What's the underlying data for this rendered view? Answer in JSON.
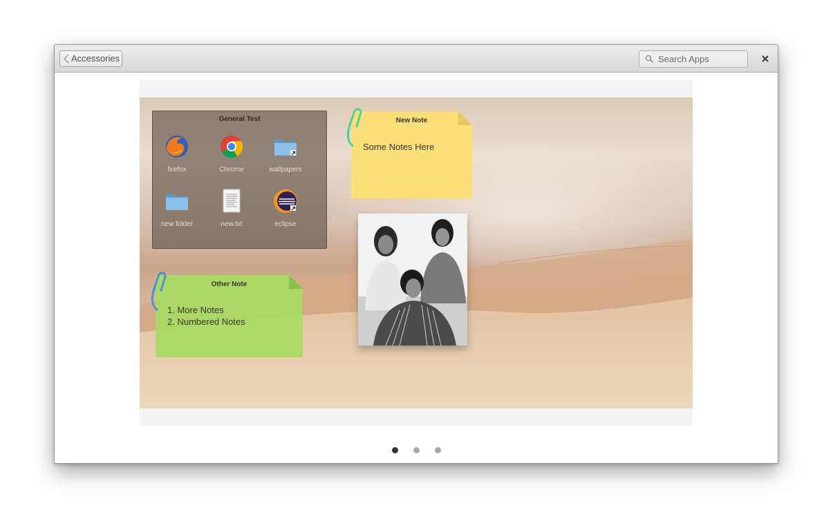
{
  "window": {
    "back_label": "Accessories",
    "search_placeholder": "Search Apps"
  },
  "folder": {
    "title": "General Test",
    "apps": [
      {
        "label": "firefox",
        "icon": "firefox-icon"
      },
      {
        "label": "Chrome",
        "icon": "chrome-icon"
      },
      {
        "label": "wallpapers",
        "icon": "folder-link-icon"
      },
      {
        "label": "new folder",
        "icon": "folder-icon"
      },
      {
        "label": "new.txt",
        "icon": "text-file-icon"
      },
      {
        "label": "eclipse",
        "icon": "eclipse-icon"
      }
    ]
  },
  "notes": {
    "new_note": {
      "title": "New Note",
      "body": "Some Notes Here",
      "color": "#fbe07a"
    },
    "other_note": {
      "title": "Other Note",
      "items": [
        "1. More Notes",
        "2. Numbered Notes"
      ],
      "color": "#a7dc62"
    }
  },
  "pager": {
    "count": 3,
    "active": 0
  },
  "colors": {
    "titlebar": "#e0e0e0",
    "note_yellow": "#fbe07a",
    "note_green": "#a7dc62",
    "clip_teal": "#4ecfa0",
    "clip_blue": "#4a90d9"
  }
}
